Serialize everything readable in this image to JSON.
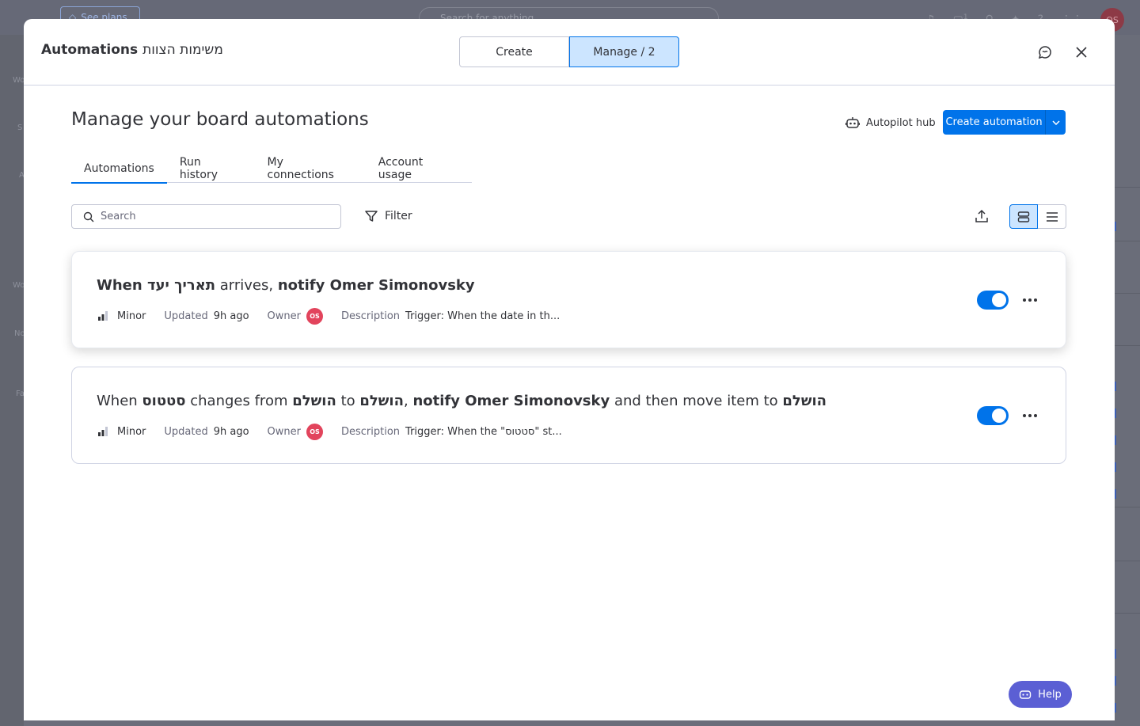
{
  "background": {
    "see_plans": "See plans",
    "search_placeholder": "Search for anything",
    "notification_count": "1",
    "avatar_initials": "OS",
    "left_labels": [
      "Wo",
      "S",
      "A",
      "Wo",
      "No",
      "Fa"
    ]
  },
  "modal": {
    "title": "Automations",
    "board_name": "משימות הצוות",
    "segments": {
      "create": "Create",
      "manage": "Manage / 2"
    }
  },
  "page": {
    "title": "Manage your board automations",
    "autopilot_hub": "Autopilot hub",
    "create_automation": "Create automation"
  },
  "tabs": [
    {
      "label": "Automations",
      "active": true
    },
    {
      "label": "Run history",
      "active": false
    },
    {
      "label": "My connections",
      "active": false
    },
    {
      "label": "Account usage",
      "active": false
    }
  ],
  "toolbar": {
    "search_placeholder": "Search",
    "filter_label": "Filter"
  },
  "automations": [
    {
      "parts": [
        {
          "t": "When ",
          "b": true
        },
        {
          "t": "תאריך יעד",
          "b": true
        },
        {
          "t": " arrives, ",
          "b": false
        },
        {
          "t": "notify Omer Simonovsky",
          "b": true
        }
      ],
      "impact_label": "Minor",
      "updated_label": "Updated",
      "updated_value": "9h ago",
      "owner_label": "Owner",
      "owner_initials": "OS",
      "description_label": "Description",
      "description_value": "Trigger: When the date in th...",
      "enabled": true
    },
    {
      "parts": [
        {
          "t": "When ",
          "b": false
        },
        {
          "t": "סטטוס",
          "b": true
        },
        {
          "t": " changes from ",
          "b": false
        },
        {
          "t": "הושלם",
          "b": true
        },
        {
          "t": " to ",
          "b": false
        },
        {
          "t": "הושלם",
          "b": true
        },
        {
          "t": ", ",
          "b": false
        },
        {
          "t": "notify Omer Simonovsky",
          "b": true
        },
        {
          "t": " and then move item to ",
          "b": false
        },
        {
          "t": "הושלם",
          "b": true
        }
      ],
      "impact_label": "Minor",
      "updated_label": "Updated",
      "updated_value": "9h ago",
      "owner_label": "Owner",
      "owner_initials": "OS",
      "description_label": "Description",
      "description_value": "Trigger: When the \"סטטוס\" st...",
      "enabled": true
    }
  ],
  "help": {
    "label": "Help"
  },
  "colors": {
    "accent": "#0073ea",
    "owner_avatar": "#e2445c",
    "help_button": "#5b5fd4"
  }
}
